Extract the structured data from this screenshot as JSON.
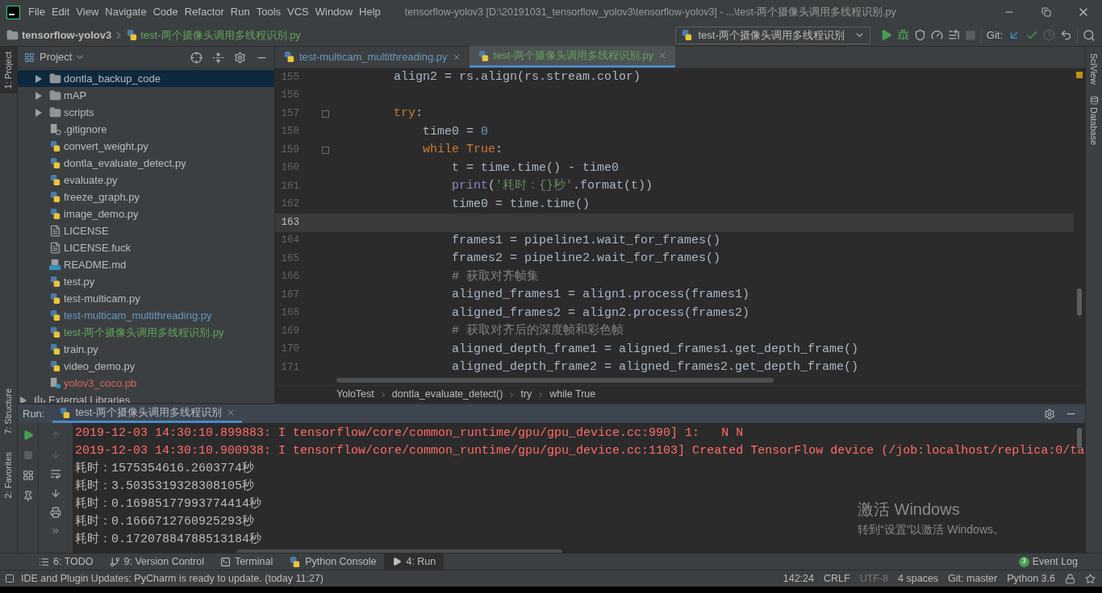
{
  "title_bar": {
    "menu": [
      "File",
      "Edit",
      "View",
      "Navigate",
      "Code",
      "Refactor",
      "Run",
      "Tools",
      "VCS",
      "Window",
      "Help"
    ],
    "title": "tensorflow-yolov3 [D:\\20191031_tensorflow_yolov3\\tensorflow-yolov3] - ...\\test-两个摄像头调用多线程识别.py"
  },
  "nav_bar": {
    "breadcrumbs": [
      "tensorflow-yolov3",
      "test-两个摄像头调用多线程识别.py"
    ],
    "run_config": "test-两个摄像头调用多线程识别",
    "git_label": "Git:",
    "stop_disabled": true,
    "history_disabled": true
  },
  "left_stripe": [
    {
      "label": "1: Project",
      "selected": true
    },
    {
      "label": "7: Structure",
      "selected": false
    },
    {
      "label": "2: Favorites",
      "selected": false
    }
  ],
  "right_stripe": [
    "SciView",
    "Database"
  ],
  "project": {
    "title": "Project",
    "items": [
      {
        "name": "dontla_backup_code",
        "kind": "folder",
        "selected": true
      },
      {
        "name": "mAP",
        "kind": "folder",
        "color": "#bbbbbb",
        "selected": false
      },
      {
        "name": "scripts",
        "kind": "folder",
        "color": "#bbbbbb",
        "selected": false
      },
      {
        "name": ".gitignore",
        "kind": "ignore",
        "color": "#bbbbbb",
        "selected": false
      },
      {
        "name": "convert_weight.py",
        "kind": "python",
        "color": "#bbbbbb",
        "selected": false
      },
      {
        "name": "dontla_evaluate_detect.py",
        "kind": "python",
        "color": "#bbbbbb",
        "selected": false
      },
      {
        "name": "evaluate.py",
        "kind": "python",
        "color": "#bbbbbb",
        "selected": false
      },
      {
        "name": "freeze_graph.py",
        "kind": "python",
        "color": "#bbbbbb",
        "selected": false
      },
      {
        "name": "image_demo.py",
        "kind": "python",
        "color": "#bbbbbb",
        "selected": false
      },
      {
        "name": "LICENSE",
        "kind": "text",
        "color": "#bbbbbb",
        "selected": false
      },
      {
        "name": "LICENSE.fuck",
        "kind": "text",
        "color": "#bbbbbb",
        "selected": false
      },
      {
        "name": "README.md",
        "kind": "markdown",
        "color": "#bbbbbb",
        "selected": false
      },
      {
        "name": "test.py",
        "kind": "python",
        "color": "#bbbbbb",
        "selected": false
      },
      {
        "name": "test-multicam.py",
        "kind": "python",
        "color": "#bbbbbb",
        "selected": false
      },
      {
        "name": "test-multicam_multithreading.py",
        "kind": "python",
        "color": "#6897bb",
        "selected": false
      },
      {
        "name": "test-两个摄像头调用多线程识别.py",
        "kind": "python",
        "color": "#62a35c",
        "selected": false
      },
      {
        "name": "train.py",
        "kind": "python",
        "color": "#bbbbbb",
        "selected": false
      },
      {
        "name": "video_demo.py",
        "kind": "python",
        "color": "#bbbbbb",
        "selected": false
      },
      {
        "name": "yolov3_coco.pb",
        "kind": "unknown",
        "color": "#d1675a",
        "selected": false
      },
      {
        "name": "External Libraries",
        "kind": "library",
        "color": "#bbbbbb",
        "selected": false
      }
    ]
  },
  "editor": {
    "tabs": [
      {
        "label": "test-multicam_multithreading.py",
        "color": "#6897bb",
        "selected": false
      },
      {
        "label": "test-两个摄像头调用多线程识别.py",
        "color": "#62a35c",
        "selected": true
      }
    ],
    "lines": [
      {
        "number": "155",
        "current": false,
        "fold": false,
        "tokens": [
          {
            "kind": "plain",
            "text": "        align2 = rs.align(rs.stream.color)"
          }
        ]
      },
      {
        "number": "156",
        "current": false,
        "fold": false
      },
      {
        "number": "157",
        "current": false,
        "fold": true,
        "tokens": [
          {
            "kind": "keyword",
            "text": "        try"
          },
          {
            "kind": "plain",
            "text": ":"
          }
        ]
      },
      {
        "number": "158",
        "current": false,
        "fold": false,
        "tokens": [
          {
            "kind": "plain",
            "text": "            time0 = "
          },
          {
            "kind": "number",
            "text": "0"
          }
        ]
      },
      {
        "number": "159",
        "current": false,
        "fold": true,
        "tokens": [
          {
            "kind": "keyword",
            "text": "            while True"
          },
          {
            "kind": "plain",
            "text": ":"
          }
        ]
      },
      {
        "number": "160",
        "current": false,
        "fold": false,
        "tokens": [
          {
            "kind": "plain",
            "text": "                t = time.time() - time0"
          }
        ]
      },
      {
        "number": "161",
        "current": false,
        "fold": false,
        "tokens": [
          {
            "kind": "builtin",
            "text": "                print"
          },
          {
            "kind": "plain",
            "text": "("
          },
          {
            "kind": "string",
            "text": "'耗时：{}秒'"
          },
          {
            "kind": "plain",
            "text": ".format(t))"
          }
        ]
      },
      {
        "number": "162",
        "current": false,
        "fold": false,
        "tokens": [
          {
            "kind": "plain",
            "text": "                time0 = time.time()"
          }
        ]
      },
      {
        "number": "163",
        "current": true,
        "fold": false
      },
      {
        "number": "164",
        "current": false,
        "fold": false,
        "tokens": [
          {
            "kind": "plain",
            "text": "                frames1 = pipeline1.wait_for_frames()"
          }
        ]
      },
      {
        "number": "165",
        "current": false,
        "fold": false,
        "tokens": [
          {
            "kind": "plain",
            "text": "                frames2 = pipeline2.wait_for_frames()"
          }
        ]
      },
      {
        "number": "166",
        "current": false,
        "fold": false,
        "tokens": [
          {
            "kind": "comment",
            "text": "                # 获取对齐帧集"
          }
        ]
      },
      {
        "number": "167",
        "current": false,
        "fold": false,
        "tokens": [
          {
            "kind": "plain",
            "text": "                aligned_frames1 = align1.process(frames1)"
          }
        ]
      },
      {
        "number": "168",
        "current": false,
        "fold": false,
        "tokens": [
          {
            "kind": "plain",
            "text": "                aligned_frames2 = align2.process(frames2)"
          }
        ]
      },
      {
        "number": "169",
        "current": false,
        "fold": false,
        "tokens": [
          {
            "kind": "comment",
            "text": "                # 获取对齐后的深度帧和彩色帧"
          }
        ]
      },
      {
        "number": "170",
        "current": false,
        "fold": false,
        "tokens": [
          {
            "kind": "plain",
            "text": "                aligned_depth_frame1 = aligned_frames1.get_depth_frame()"
          }
        ]
      },
      {
        "number": "171",
        "current": false,
        "fold": false,
        "tokens": [
          {
            "kind": "plain",
            "text": "                aligned_depth_frame2 = aligned_frames2.get_depth_frame()"
          }
        ]
      }
    ],
    "breadcrumbs": [
      "YoloTest",
      "dontla_evaluate_detect()",
      "try",
      "while True"
    ]
  },
  "run": {
    "label": "Run:",
    "tab": "test-两个摄像头调用多线程识别",
    "output": [
      {
        "kind": "error",
        "text": "2019-12-03 14:30:10.899883: I tensorflow/core/common_runtime/gpu/gpu_device.cc:990] 1:   N N"
      },
      {
        "kind": "error",
        "text": "2019-12-03 14:30:10.900938: I tensorflow/core/common_runtime/gpu/gpu_device.cc:1103] Created TensorFlow device (/job:localhost/replica:0/ta"
      },
      {
        "kind": "output",
        "text": "耗时：1575354616.2603774秒"
      },
      {
        "kind": "output",
        "text": "耗时：3.5035319328308105秒"
      },
      {
        "kind": "output",
        "text": "耗时：0.16985177993774414秒"
      },
      {
        "kind": "output",
        "text": "耗时：0.1666712760925293秒"
      },
      {
        "kind": "output",
        "text": "耗时：0.17207884788513184秒"
      }
    ]
  },
  "os_notice": {
    "title": "激活 Windows",
    "text": "转到“设置”以激活 Windows。"
  },
  "tool_tabs": [
    {
      "label": "6: TODO",
      "kind": "list",
      "selected": false
    },
    {
      "label": "9: Version Control",
      "kind": "vcs",
      "selected": false
    },
    {
      "label": "Terminal",
      "kind": "terminal",
      "selected": false
    },
    {
      "label": "Python Console",
      "kind": "python",
      "selected": false
    },
    {
      "label": "4: Run",
      "kind": "run",
      "selected": true
    }
  ],
  "event_log": {
    "label": "Event Log",
    "count": "3"
  },
  "status_bar": {
    "message": "IDE and Plugin Updates: PyCharm is ready to update. (today 11:27)",
    "items": [
      {
        "text": "142:24",
        "disabled": false
      },
      {
        "text": "CRLF",
        "disabled": false
      },
      {
        "text": "UTF-8",
        "disabled": true
      },
      {
        "text": "4 spaces",
        "disabled": false
      },
      {
        "text": "Git: master",
        "disabled": false
      },
      {
        "text": "Python 3.6",
        "disabled": false
      }
    ]
  }
}
